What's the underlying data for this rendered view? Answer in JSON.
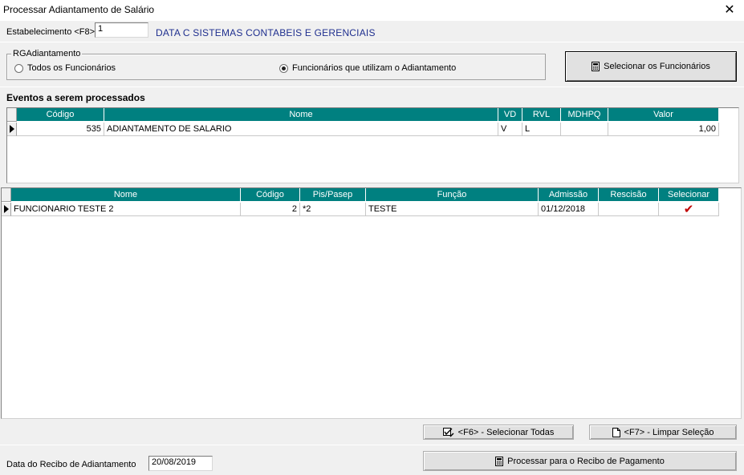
{
  "window": {
    "title": "Processar Adiantamento de Salário",
    "close_glyph": "✕"
  },
  "header": {
    "estabelecimento_label": "Estabelecimento <F8>",
    "estabelecimento_value": "1",
    "company_name": "DATA C SISTEMAS CONTABEIS E GERENCIAIS"
  },
  "rg_group": {
    "legend": "RGAdiantamento",
    "option_all": "Todos os Funcionários",
    "option_advance": "Funcionários que utilizam o Adiantamento",
    "selected": "option_advance"
  },
  "select_employees_button": "Selecionar os Funcionários",
  "events": {
    "title": "Eventos a serem processados",
    "columns": [
      "Código",
      "Nome",
      "VD",
      "RVL",
      "MDHPQ",
      "Valor"
    ],
    "rows": [
      {
        "codigo": "535",
        "nome": "ADIANTAMENTO DE SALARIO",
        "vd": "V",
        "rvl": "L",
        "mdhpq": "",
        "valor": "1,00"
      }
    ]
  },
  "employees": {
    "columns": [
      "Nome",
      "Código",
      "Pis/Pasep",
      "Função",
      "Admissão",
      "Rescisão",
      "Selecionar"
    ],
    "rows": [
      {
        "nome": "FUNCIONARIO TESTE 2",
        "codigo": "2",
        "pis": "*2",
        "funcao": "TESTE",
        "admissao": "01/12/2018",
        "rescisao": "",
        "selecionado": "✔"
      }
    ]
  },
  "actions": {
    "select_all": "<F6> - Selecionar Todas",
    "clear_selection": "<F7> - Limpar Seleção",
    "process": "Processar para o Recibo de Pagamento"
  },
  "footer": {
    "receipt_date_label": "Data do Recibo de Adiantamento",
    "receipt_date_value": "20/08/2019"
  },
  "icons": {
    "calculator": "calculator-icon",
    "select_all": "check-edit-icon",
    "clear": "document-icon",
    "check_color": "#c00000"
  }
}
